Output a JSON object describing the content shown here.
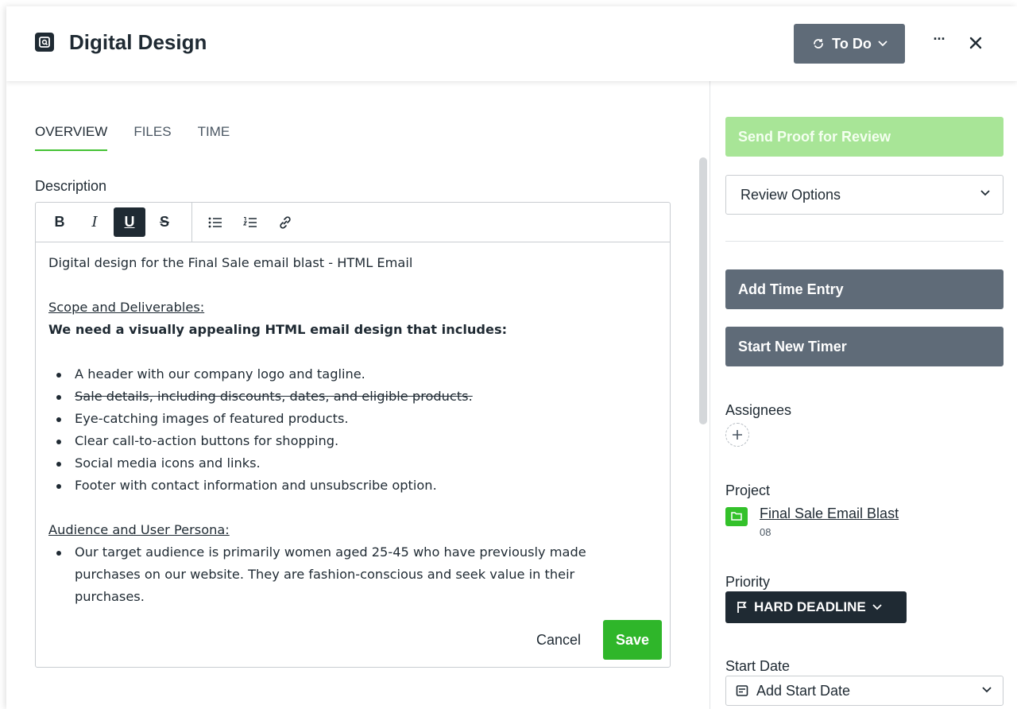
{
  "header": {
    "title": "Digital Design",
    "status_label": "To Do",
    "more_label": "···"
  },
  "tabs": [
    {
      "label": "OVERVIEW",
      "active": true
    },
    {
      "label": "FILES",
      "active": false
    },
    {
      "label": "TIME",
      "active": false
    }
  ],
  "description": {
    "label": "Description",
    "toolbar": {
      "bold": "B",
      "italic": "I",
      "underline": "U",
      "strike": "S"
    },
    "intro": "Digital design for the Final Sale email blast - HTML Email",
    "scope_heading": "Scope and Deliverables:",
    "scope_bold": "We need a visually appealing HTML email design that includes:",
    "scope_items": [
      {
        "text": "A header with our company logo and tagline.",
        "strike": false
      },
      {
        "text": "Sale details, including discounts, dates, and eligible products.",
        "strike": true
      },
      {
        "text": "Eye-catching images of featured products.",
        "strike": false
      },
      {
        "text": "Clear call-to-action buttons for shopping.",
        "strike": false
      },
      {
        "text": "Social media icons and links.",
        "strike": false
      },
      {
        "text": "Footer with contact information and unsubscribe option.",
        "strike": false
      }
    ],
    "audience_heading": "Audience and User Persona:",
    "audience_items": [
      "Our target audience is primarily women aged 25-45 who have previously made purchases on our website. They are fashion-conscious and seek value in their purchases."
    ],
    "cancel_label": "Cancel",
    "save_label": "Save"
  },
  "sidebar": {
    "send_proof_label": "Send Proof for Review",
    "review_options_label": "Review Options",
    "add_time_entry_label": "Add Time Entry",
    "start_timer_label": "Start New Timer",
    "assignees_label": "Assignees",
    "project_label": "Project",
    "project_name": "Final Sale Email Blast",
    "project_code": "08",
    "priority_label": "Priority",
    "priority_value": "HARD DEADLINE",
    "start_date_label": "Start Date",
    "start_date_placeholder": "Add Start Date"
  },
  "colors": {
    "accent_green": "#2fb62a",
    "tab_underline": "#44c234",
    "slate_button": "#5f6b78",
    "dark": "#1f2a33",
    "proof_disabled": "#a8e597"
  }
}
